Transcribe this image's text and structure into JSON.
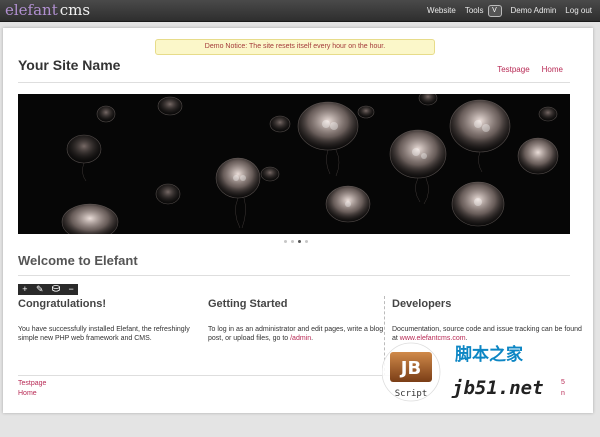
{
  "topbar": {
    "logo_part1": "elefant",
    "logo_part2": "cms",
    "nav": {
      "website": "Website",
      "tools": "Tools",
      "tools_badge": "V",
      "user": "Demo Admin",
      "logout": "Log out"
    }
  },
  "notice": "Demo Notice: The site resets itself every hour on the hour.",
  "site_name": "Your Site Name",
  "menu": [
    "Testpage",
    "Home"
  ],
  "slider": {
    "dots": 4,
    "active_index": 2
  },
  "welcome": "Welcome to Elefant",
  "edit_toolbar": {
    "add": "+",
    "edit": "✎",
    "delete": "−"
  },
  "columns": [
    {
      "heading": "Congratulations!",
      "body": "You have successfully installed Elefant, the refreshingly simple new PHP web framework and CMS."
    },
    {
      "heading": "Getting Started",
      "body_prefix": "To log in as an administrator and edit pages, write a blog post, or upload files, go to ",
      "body_link": "/admin",
      "body_suffix": "."
    },
    {
      "heading": "Developers",
      "body_prefix": "Documentation, source code and issue tracking can be found at ",
      "body_link": "www.elefantcms.com",
      "body_suffix": "."
    }
  ],
  "footer_links": [
    "Testpage",
    "Home"
  ],
  "footer_right": [
    "5",
    "n"
  ],
  "watermark": {
    "badge": "JB",
    "badge_sub": "Script",
    "cn": "脚本之家",
    "url": "jb51.net"
  },
  "colors": {
    "accent": "#b82a55",
    "logo_purple": "#b08fcf",
    "topbar": "#3a3a3a",
    "notice_bg": "#fbf7c9"
  }
}
